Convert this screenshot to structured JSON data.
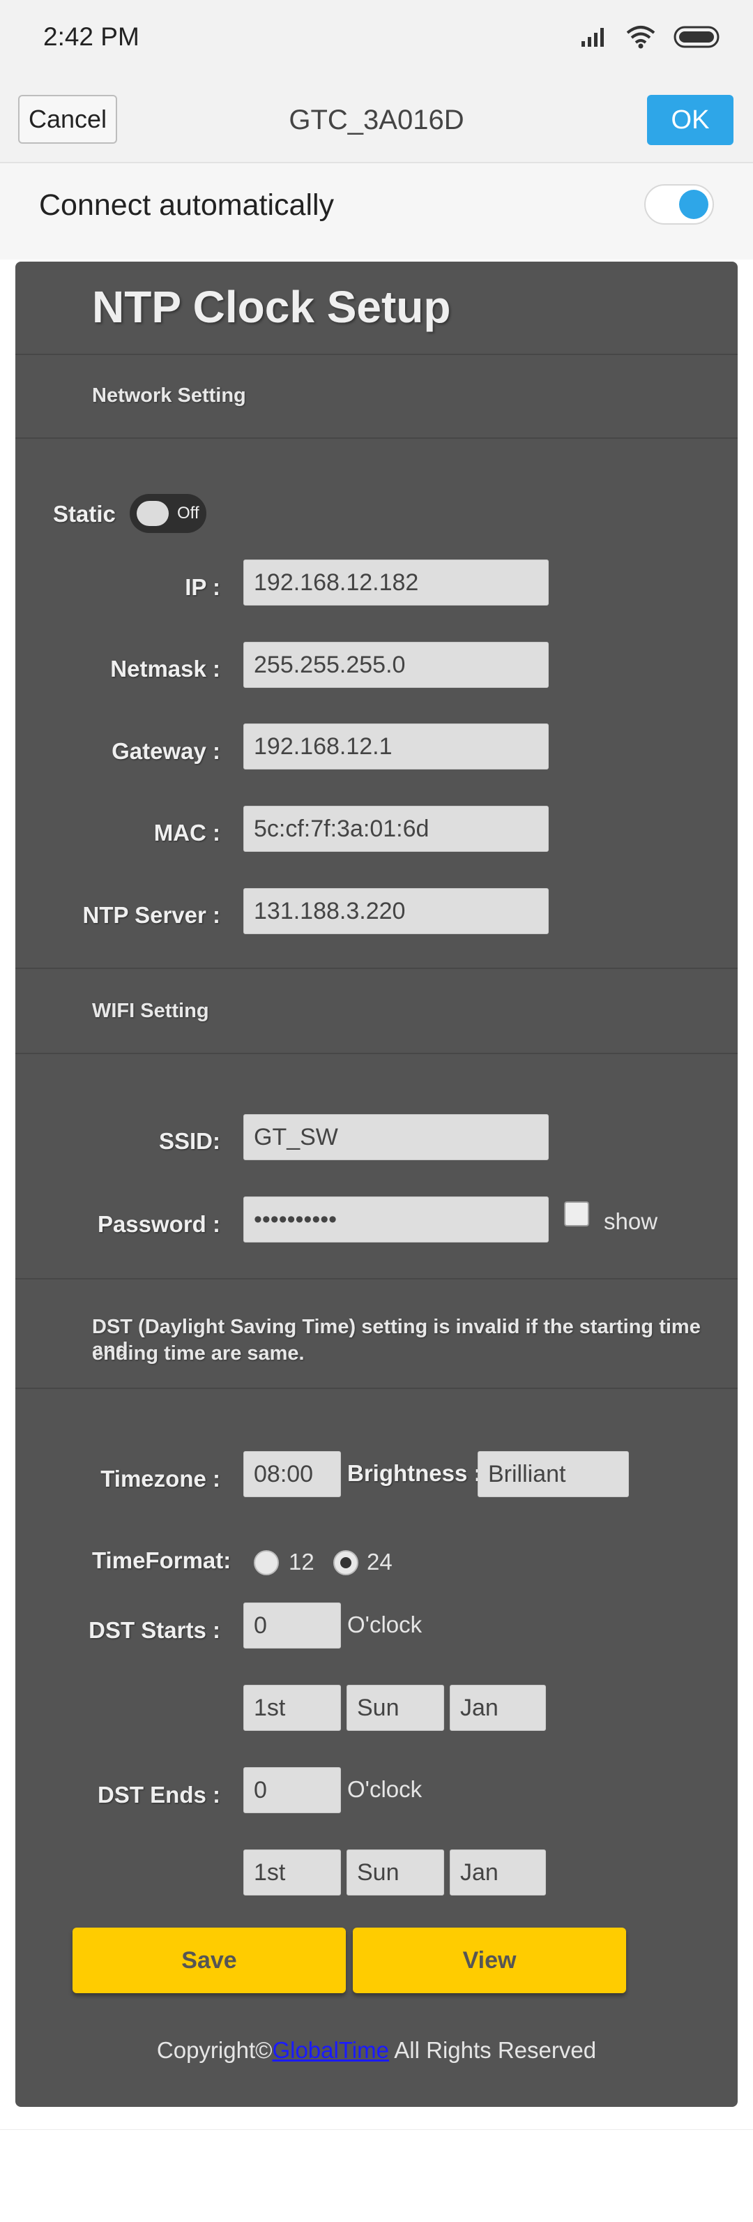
{
  "status_bar": {
    "time": "2:42 PM"
  },
  "header": {
    "cancel_label": "Cancel",
    "title": "GTC_3A016D",
    "ok_label": "OK"
  },
  "auto_connect": {
    "label": "Connect automatically",
    "enabled": true
  },
  "page": {
    "title": "NTP Clock Setup",
    "network_section": "Network Setting",
    "static_label": "Static",
    "static_state": "Off",
    "ip_label": "IP :",
    "ip_value": "192.168.12.182",
    "netmask_label": "Netmask :",
    "netmask_value": "255.255.255.0",
    "gateway_label": "Gateway :",
    "gateway_value": "192.168.12.1",
    "mac_label": "MAC :",
    "mac_value": "5c:cf:7f:3a:01:6d",
    "ntp_label": "NTP Server :",
    "ntp_value": "131.188.3.220",
    "wifi_section": "WIFI Setting",
    "ssid_label": "SSID:",
    "ssid_value": "GT_SW",
    "password_label": "Password :",
    "password_value": "••••••••••",
    "show_label": "show",
    "dst_note_line1": "DST (Daylight Saving Time) setting is invalid if the starting time and",
    "dst_note_line2": "ending time are same.",
    "timezone_label": "Timezone :",
    "timezone_value": "08:00",
    "brightness_label": "Brightness :",
    "brightness_value": "Brilliant",
    "timeformat_label": "TimeFormat:",
    "timeformat_opt1": "12",
    "timeformat_opt2": "24",
    "timeformat_selected": "24",
    "dst_starts_label": "DST Starts :",
    "dst_starts_hour": "0",
    "oclock_label": "O'clock",
    "dst_starts_week": "1st",
    "dst_starts_day": "Sun",
    "dst_starts_month": "Jan",
    "dst_ends_label": "DST Ends :",
    "dst_ends_hour": "0",
    "dst_ends_week": "1st",
    "dst_ends_day": "Sun",
    "dst_ends_month": "Jan",
    "save_label": "Save",
    "view_label": "View",
    "copyright_prefix": "Copyright©",
    "copyright_link": "GlobalTime",
    "copyright_suffix": " All Rights Reserved"
  },
  "colors": {
    "accent": "#2ea6e8",
    "panel": "#545454",
    "button": "#ffcc00"
  }
}
